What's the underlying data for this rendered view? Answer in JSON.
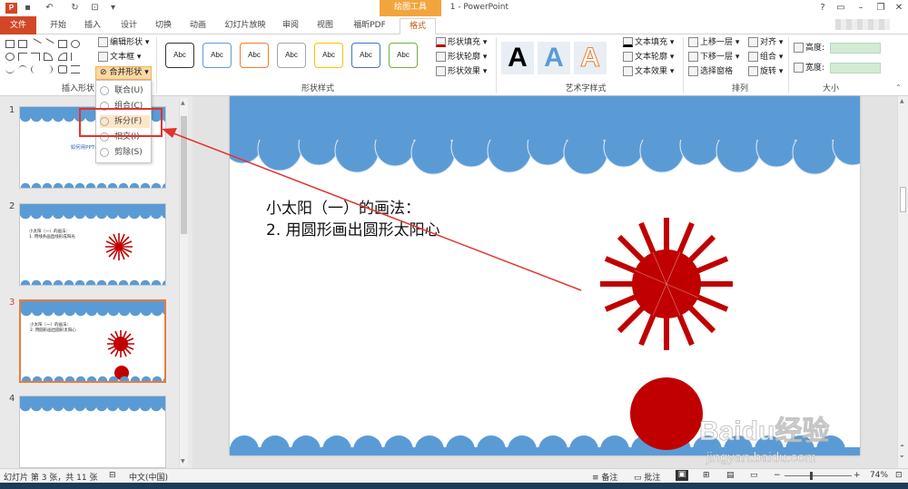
{
  "titlebar": {
    "title": "1 - PowerPoint",
    "tools_context": "绘图工具",
    "app_icon": "P"
  },
  "tabs": [
    "文件",
    "开始",
    "插入",
    "设计",
    "切换",
    "动画",
    "幻灯片放映",
    "审阅",
    "视图",
    "福昕PDF",
    "格式"
  ],
  "ribbon": {
    "insert_shapes": {
      "label": "插入形状",
      "edit_shape": "编辑形状",
      "text_box": "文本框",
      "merge_shapes": "合并形状"
    },
    "shape_styles": {
      "label": "形状样式",
      "sample_text": "Abc",
      "fill": "形状填充",
      "outline": "形状轮廓",
      "effects": "形状效果"
    },
    "wordart": {
      "label": "艺术字样式",
      "sample": "A",
      "text_fill": "文本填充",
      "text_outline": "文本轮廓",
      "text_effects": "文本效果"
    },
    "arrange": {
      "label": "排列",
      "bring_forward": "上移一层",
      "send_backward": "下移一层",
      "selection_pane": "选择窗格",
      "align": "对齐",
      "group": "组合",
      "rotate": "旋转"
    },
    "size": {
      "label": "大小",
      "height": "高度:",
      "width": "宽度:"
    }
  },
  "merge_menu": [
    "联合(U)",
    "组合(C)",
    "拆分(F)",
    "相交(I)",
    "剪除(S)"
  ],
  "thumbnails": [
    {
      "num": "1",
      "title": "如何用PPT画小太阳"
    },
    {
      "num": "2",
      "line1": "小太阳（一）的画法：",
      "line2": "1. 用线条画直线形成阳光"
    },
    {
      "num": "3",
      "line1": "小太阳（一）的画法：",
      "line2": "2. 用圆形画出圆形太阳心"
    },
    {
      "num": "4"
    }
  ],
  "slide": {
    "line1": "小太阳（一）的画法：",
    "line2": "2. 用圆形画出圆形太阳心"
  },
  "status": {
    "slide_info": "幻灯片 第 3 张，共 11 张",
    "language": "中文(中国)",
    "notes": "备注",
    "comments": "批注",
    "zoom": "74%"
  },
  "watermark": {
    "brand": "Baidu经验",
    "url": "jingyan.baidu.com"
  },
  "colors": {
    "accent": "#d24726",
    "sun": "#c00000",
    "sky": "#5b9bd5",
    "tools": "#f2a53d"
  }
}
